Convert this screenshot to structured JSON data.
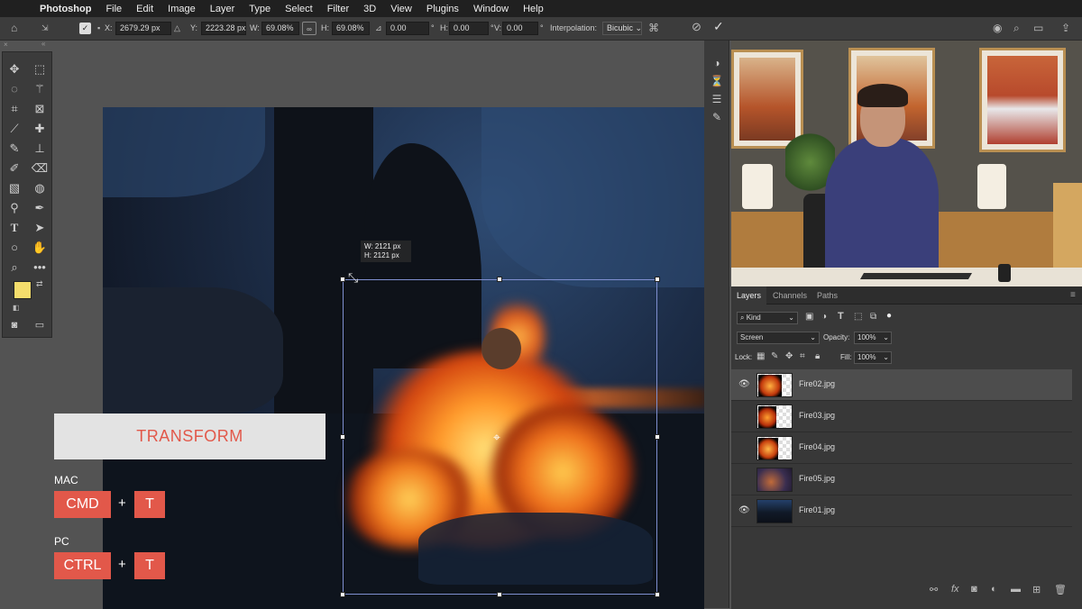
{
  "menu": {
    "apple": "",
    "items": [
      "Photoshop",
      "File",
      "Edit",
      "Image",
      "Layer",
      "Type",
      "Select",
      "Filter",
      "3D",
      "View",
      "Plugins",
      "Window",
      "Help"
    ]
  },
  "options": {
    "x_label": "X:",
    "x_value": "2679.29 px",
    "y_label": "Y:",
    "y_value": "2223.28 px",
    "w_label": "W:",
    "w_value": "69.08%",
    "h_label": "H:",
    "h_value": "69.08%",
    "angle_value": "0.00",
    "angle_unit": "°",
    "hskew_label": "H:",
    "hskew_value": "0.00",
    "hskew_unit": "°",
    "vskew_label": "V:",
    "vskew_value": "0.00",
    "vskew_unit": "°",
    "interp_label": "Interpolation:",
    "interp_value": "Bicubic"
  },
  "transform_tooltip": {
    "w": "W: 2121 px",
    "h": "H: 2121 px"
  },
  "overlay": {
    "title": "TRANSFORM",
    "mac_label": "MAC",
    "mac_key1": "CMD",
    "mac_plus": "+",
    "mac_key2": "T",
    "pc_label": "PC",
    "pc_key1": "CTRL",
    "pc_plus": "+",
    "pc_key2": "T"
  },
  "layers_panel": {
    "tabs": [
      "Layers",
      "Channels",
      "Paths"
    ],
    "filter_kind": "Kind",
    "blend_mode": "Screen",
    "opacity_label": "Opacity:",
    "opacity_value": "100%",
    "lock_label": "Lock:",
    "fill_label": "Fill:",
    "fill_value": "100%",
    "layers": [
      {
        "name": "Fire02.jpg",
        "visible": true,
        "selected": true
      },
      {
        "name": "Fire03.jpg",
        "visible": false,
        "selected": false
      },
      {
        "name": "Fire04.jpg",
        "visible": false,
        "selected": false
      },
      {
        "name": "Fire05.jpg",
        "visible": false,
        "selected": false
      },
      {
        "name": "Fire01.jpg",
        "visible": true,
        "selected": false
      }
    ]
  },
  "colors": {
    "foreground": "#f4dd6c",
    "background": "#111111",
    "accent": "#e2584a",
    "selection_frame": "#7f8fd0"
  }
}
